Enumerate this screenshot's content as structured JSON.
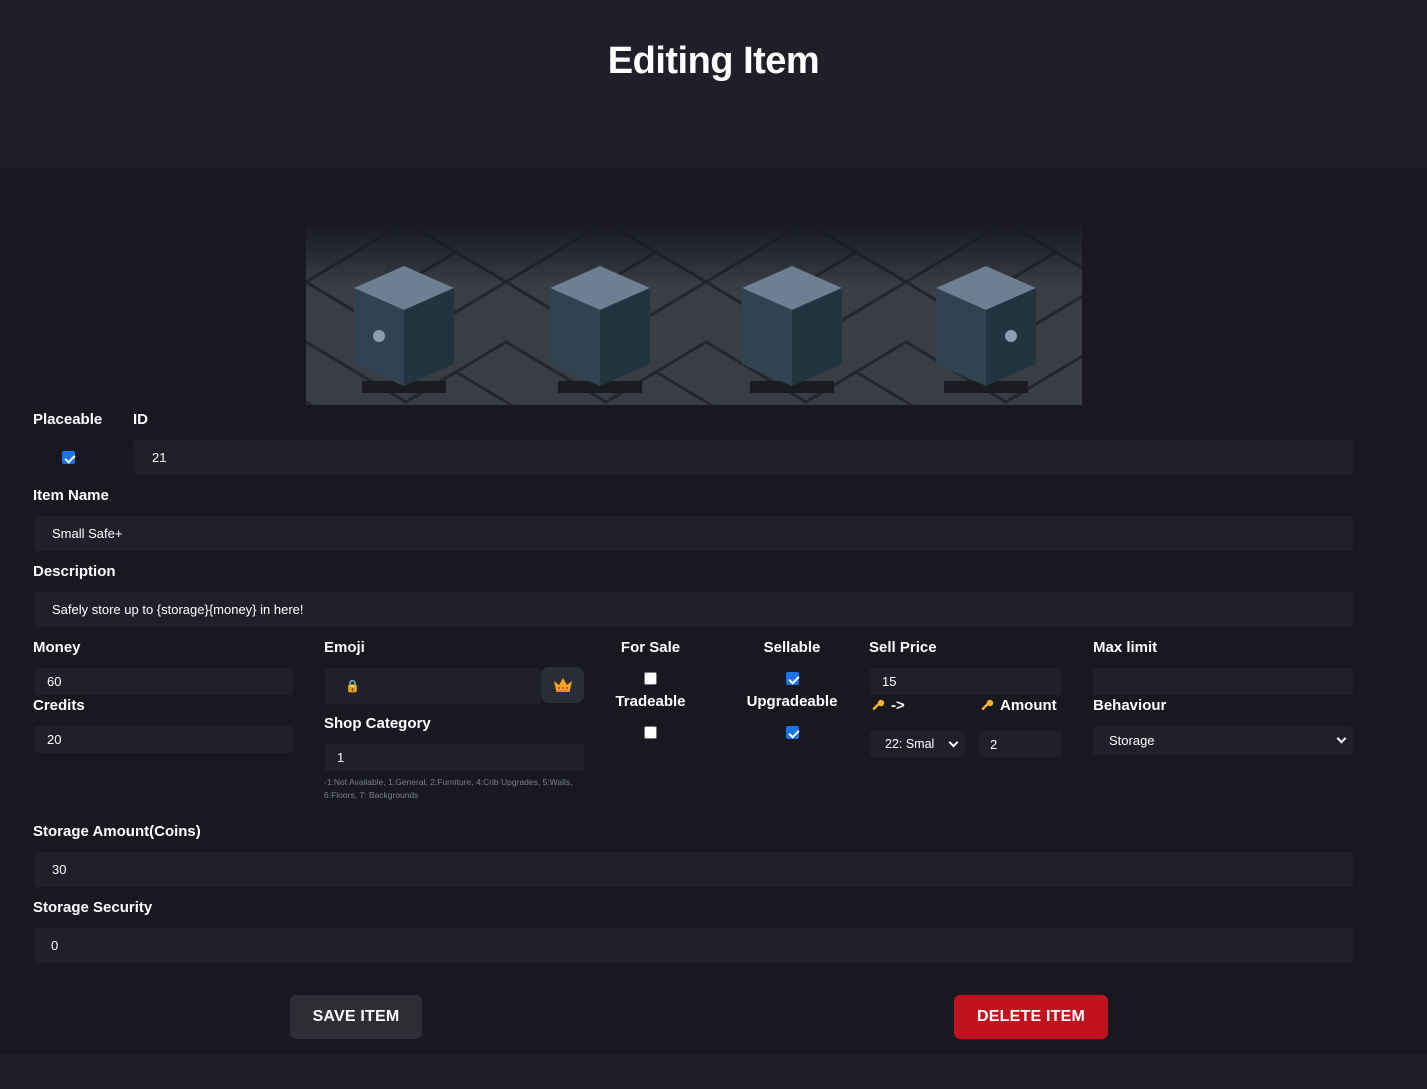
{
  "page": {
    "title": "Editing Item"
  },
  "form": {
    "placeable": {
      "label": "Placeable",
      "checked": true
    },
    "id": {
      "label": "ID",
      "value": "21"
    },
    "item_name": {
      "label": "Item Name",
      "value": "Small Safe+"
    },
    "description": {
      "label": "Description",
      "value": "Safely store up to {storage}{money} in here!"
    },
    "money": {
      "label": "Money",
      "value": "60"
    },
    "credits": {
      "label": "Credits",
      "value": "20"
    },
    "emoji": {
      "label": "Emoji",
      "value": "🔒",
      "picker_icon": "crown-icon"
    },
    "shop_category": {
      "label": "Shop Category",
      "value": "1",
      "hint": "-1:Not Available, 1:General, 2:Furniture, 4:Crib Upgrades, 5:Walls, 6:Floors, 7: Backgrounds"
    },
    "for_sale": {
      "label": "For Sale",
      "checked": false
    },
    "tradeable": {
      "label": "Tradeable",
      "checked": false
    },
    "sellable": {
      "label": "Sellable",
      "checked": true
    },
    "upgradeable": {
      "label": "Upgradeable",
      "checked": true
    },
    "sell_price": {
      "label": "Sell Price",
      "value": "15"
    },
    "upgrade_target": {
      "label": "->",
      "icon": "key-icon",
      "selected": "22: Smal"
    },
    "upgrade_amount": {
      "label": "Amount",
      "icon": "key-icon",
      "value": "2"
    },
    "max_limit": {
      "label": "Max limit",
      "value": ""
    },
    "behaviour": {
      "label": "Behaviour",
      "selected": "Storage"
    },
    "storage_amount": {
      "label": "Storage Amount(Coins)",
      "value": "30"
    },
    "storage_security": {
      "label": "Storage Security",
      "value": "0"
    }
  },
  "actions": {
    "save_label": "SAVE ITEM",
    "delete_label": "DELETE ITEM"
  },
  "colors": {
    "accent": "#1a73e8",
    "danger": "#c1121f",
    "background": "#171820",
    "field": "#1f2029"
  }
}
